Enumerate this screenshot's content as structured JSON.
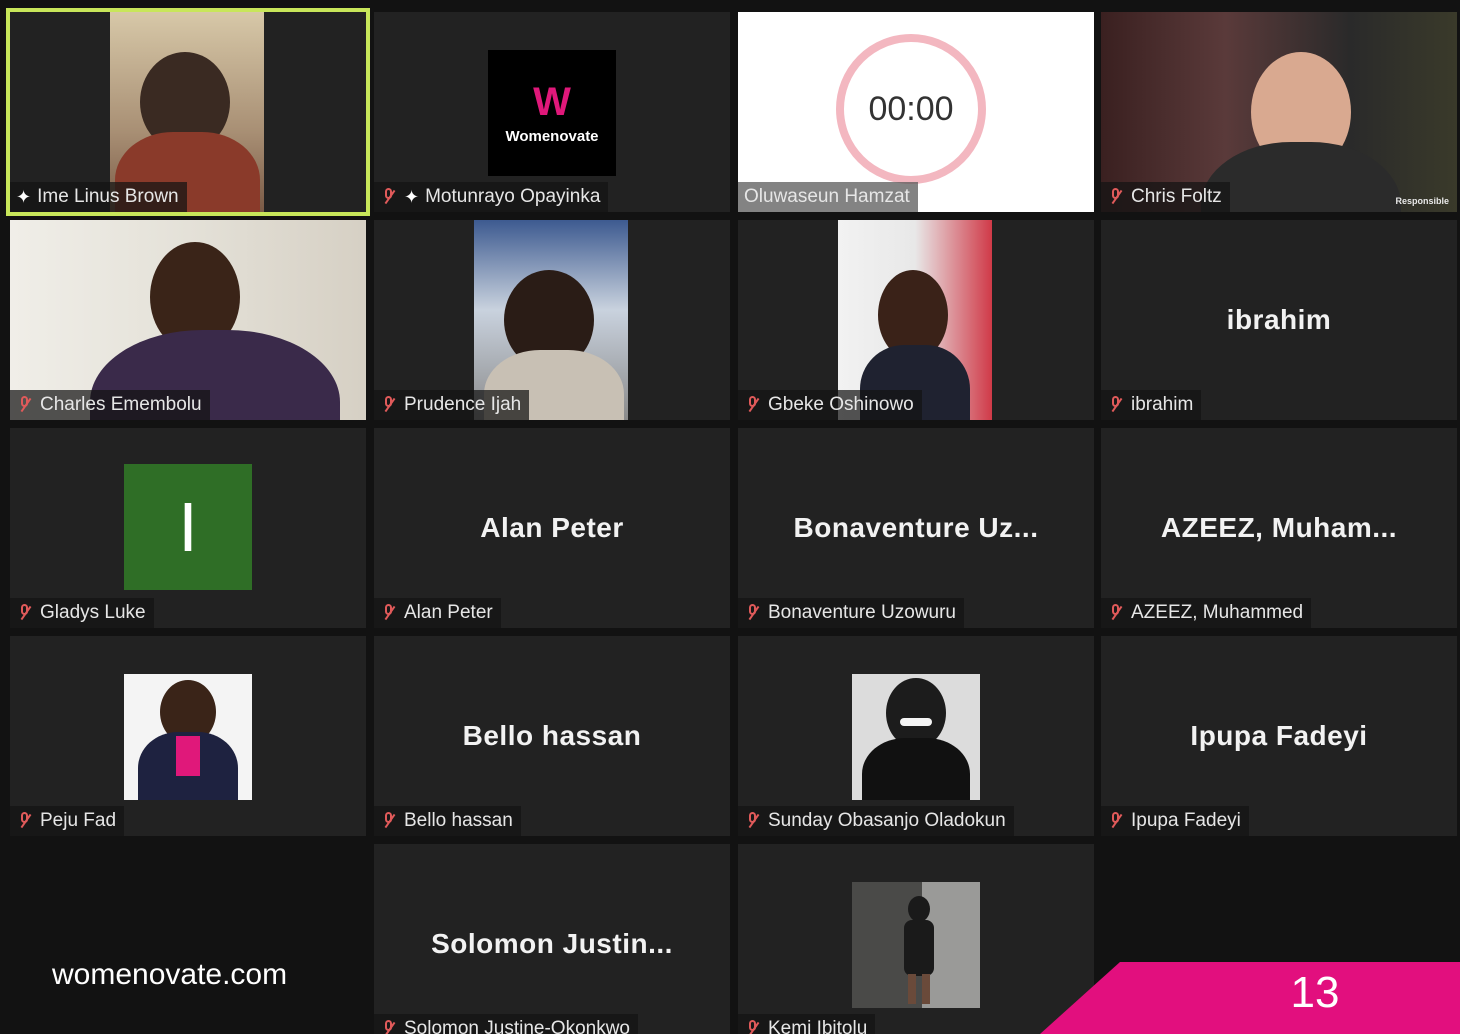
{
  "colors": {
    "background": "#121212",
    "tile": "#222222",
    "speaker_outline": "#c8e65a",
    "muted_icon": "#e05a5a",
    "brand_pink": "#e20f7e",
    "avatar_green": "#2f6e26"
  },
  "participants": [
    {
      "name": "Ime Linus Brown",
      "pinned": true,
      "muted": false,
      "active_speaker": true,
      "display": "video"
    },
    {
      "name": "Motunrayo Opayinka",
      "pinned": true,
      "muted": true,
      "display": "logo",
      "logo_text": "Womenovate"
    },
    {
      "name": "Oluwaseun Hamzat",
      "muted": false,
      "display": "timer",
      "timer": "00:00"
    },
    {
      "name": "Chris Foltz",
      "muted": true,
      "display": "video",
      "overlay_text": "Responsible"
    },
    {
      "name": "Charles Emembolu",
      "muted": true,
      "display": "video"
    },
    {
      "name": "Prudence Ijah",
      "muted": true,
      "display": "video"
    },
    {
      "name": "Gbeke Oshinowo",
      "muted": true,
      "display": "video"
    },
    {
      "name": "ibrahim",
      "muted": true,
      "display": "name",
      "big_name": "ibrahim"
    },
    {
      "name": "Gladys Luke",
      "muted": true,
      "display": "avatar",
      "avatar_letter": "I"
    },
    {
      "name": "Alan Peter",
      "muted": true,
      "display": "name",
      "big_name": "Alan Peter"
    },
    {
      "name": "Bonaventure Uzowuru",
      "muted": true,
      "display": "name",
      "big_name": "Bonaventure Uz..."
    },
    {
      "name": "AZEEZ, Muhammed",
      "muted": true,
      "display": "name",
      "big_name": "AZEEZ, Muham..."
    },
    {
      "name": "Peju Fad",
      "muted": true,
      "display": "photo"
    },
    {
      "name": "Bello hassan",
      "muted": true,
      "display": "name",
      "big_name": "Bello hassan"
    },
    {
      "name": "Sunday Obasanjo Oladokun",
      "muted": true,
      "display": "photo"
    },
    {
      "name": "Ipupa Fadeyi",
      "muted": true,
      "display": "name",
      "big_name": "Ipupa Fadeyi"
    },
    {
      "name": "Solomon Justine-Okonkwo",
      "muted": true,
      "display": "name",
      "big_name": "Solomon Justin..."
    },
    {
      "name": "Kemi Ibitolu",
      "muted": true,
      "display": "photo"
    }
  ],
  "footer": {
    "url": "womenovate.com",
    "page_number": "13"
  }
}
